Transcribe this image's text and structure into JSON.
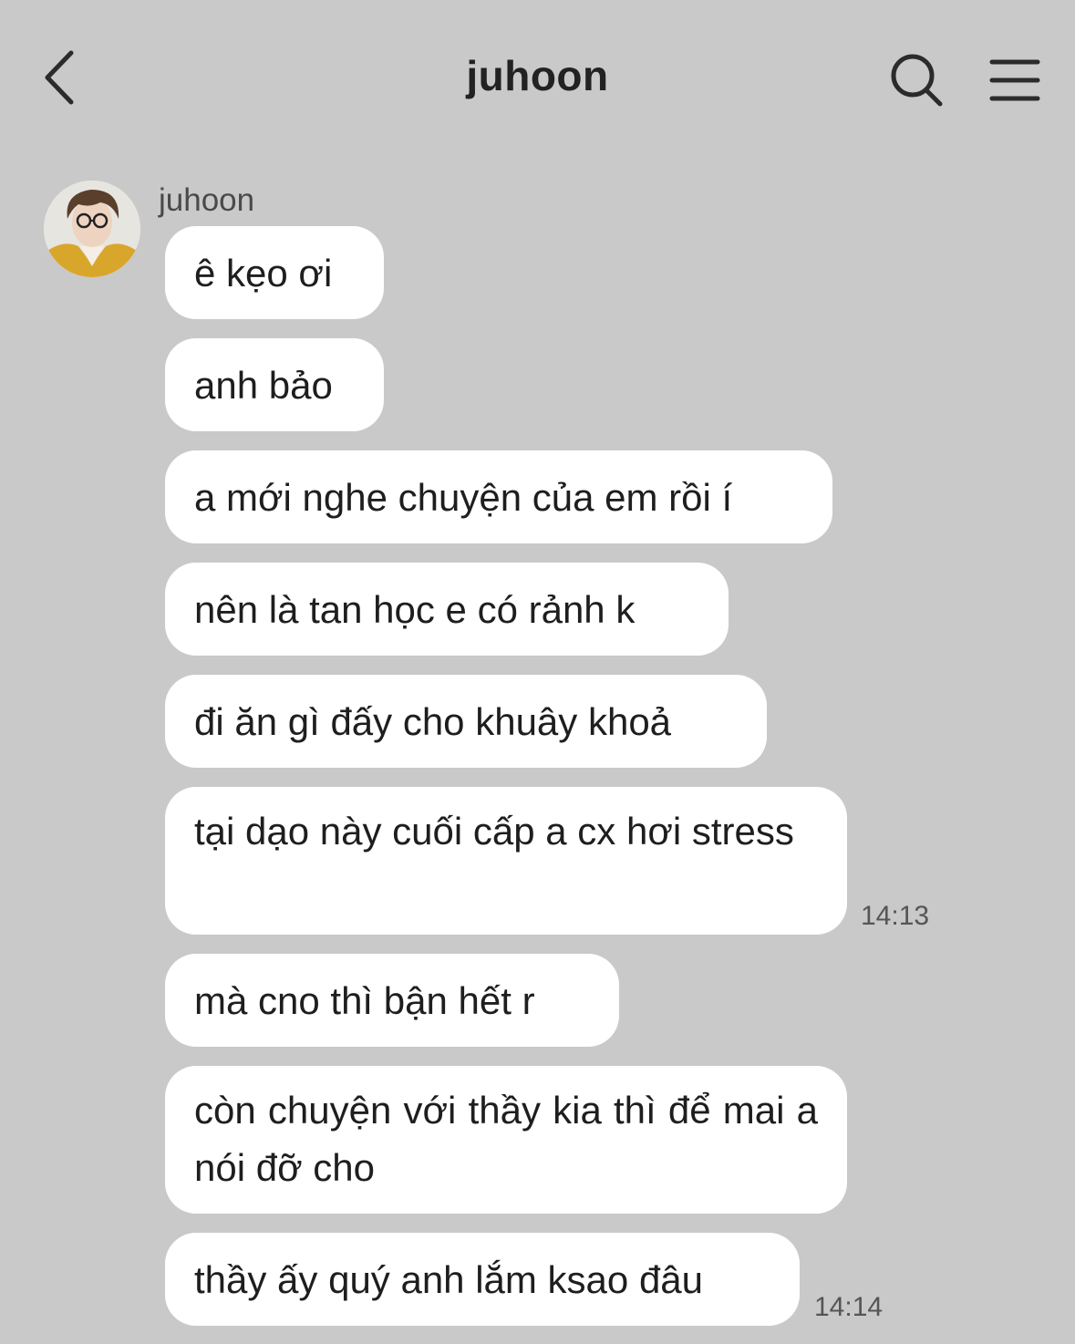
{
  "header": {
    "title": "juhoon",
    "back_icon": "chevron-left-icon",
    "search_icon": "search-icon",
    "menu_icon": "hamburger-menu-icon"
  },
  "chat": {
    "sender_name": "juhoon",
    "messages": [
      {
        "text": "ê kẹo ơi"
      },
      {
        "text": "anh bảo"
      },
      {
        "text": "a mới nghe chuyện của em rồi í"
      },
      {
        "text": "nên là tan học e có rảnh k"
      },
      {
        "text": "đi ăn gì đấy cho khuây khoả"
      },
      {
        "text": "tại dạo này cuối cấp a cx hơi stress",
        "time": "14:13"
      },
      {
        "text": "mà cno thì bận hết r"
      },
      {
        "text": "còn chuyện với thầy kia thì để mai a nói đỡ cho"
      },
      {
        "text": "thầy ấy quý anh lắm ksao đâu",
        "time": "14:14"
      }
    ]
  },
  "colors": {
    "background": "#c9c9c9",
    "bubble": "#ffffff",
    "text": "#1e1e1e"
  }
}
